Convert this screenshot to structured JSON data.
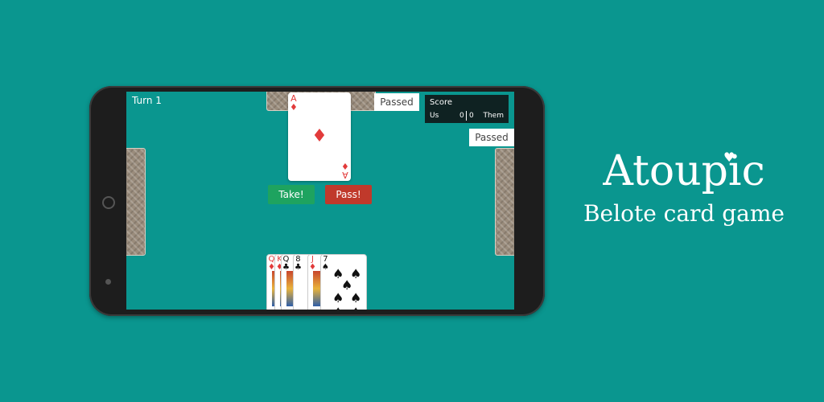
{
  "game": {
    "turn_label": "Turn 1",
    "top_status": "Passed",
    "right_status": "Passed",
    "score": {
      "title": "Score",
      "us_label": "Us",
      "us_value": "0",
      "them_value": "0",
      "them_label": "Them"
    },
    "trump_card": {
      "rank": "A",
      "suit_symbol": "♦"
    },
    "take_label": "Take!",
    "pass_label": "Pass!",
    "hand": [
      {
        "rank": "Q",
        "suit": "♦",
        "color": "red"
      },
      {
        "rank": "K",
        "suit": "♦",
        "color": "red"
      },
      {
        "rank": "Q",
        "suit": "♣",
        "color": "blk"
      },
      {
        "rank": "8",
        "suit": "♣",
        "color": "blk"
      },
      {
        "rank": "J",
        "suit": "♦",
        "color": "red"
      },
      {
        "rank": "7",
        "suit": "♠",
        "color": "blk"
      }
    ]
  },
  "brand": {
    "title": "Atoupic",
    "subtitle": "Belote card game"
  },
  "colors": {
    "felt": "#0a968f",
    "take": "#1ea35f",
    "pass": "#c0392b"
  },
  "icons": {
    "home": "home-button-icon",
    "heart": "heart-icon"
  }
}
